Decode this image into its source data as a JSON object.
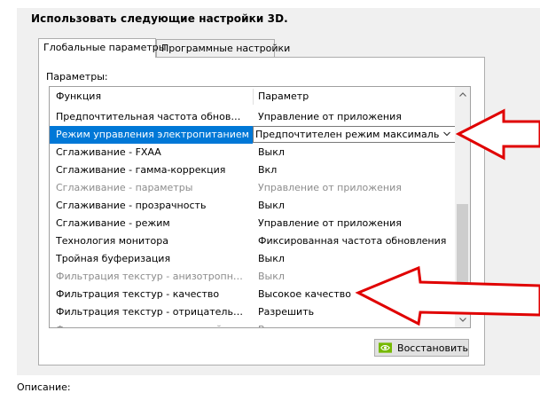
{
  "section_title": "Использовать следующие настройки 3D.",
  "tabs": [
    {
      "label": "Глобальные параметры",
      "active": true
    },
    {
      "label": "Программные настройки",
      "active": false
    }
  ],
  "params_label": "Параметры:",
  "grid": {
    "headers": {
      "function": "Функция",
      "parameter": "Параметр"
    },
    "rows": [
      {
        "function": "Предпочтительная частота обновлени...",
        "value": "Управление от приложения",
        "state": "normal"
      },
      {
        "function": "Режим управления электропитанием",
        "value": "Предпочтителен режим максимальной пр",
        "state": "selected"
      },
      {
        "function": "Сглаживание - FXAA",
        "value": "Выкл",
        "state": "normal"
      },
      {
        "function": "Сглаживание - гамма-коррекция",
        "value": "Вкл",
        "state": "normal"
      },
      {
        "function": "Сглаживание - параметры",
        "value": "Управление от приложения",
        "state": "disabled"
      },
      {
        "function": "Сглаживание - прозрачность",
        "value": "Выкл",
        "state": "normal"
      },
      {
        "function": "Сглаживание - режим",
        "value": "Управление от приложения",
        "state": "normal"
      },
      {
        "function": "Технология монитора",
        "value": "Фиксированная частота обновления",
        "state": "normal"
      },
      {
        "function": "Тройная буферизация",
        "value": "Выкл",
        "state": "normal"
      },
      {
        "function": "Фильтрация текстур - анизотропная оп...",
        "value": "Выкл",
        "state": "disabled"
      },
      {
        "function": "Фильтрация текстур - качество",
        "value": "Высокое качество",
        "state": "normal"
      },
      {
        "function": "Фильтрация текстур - отрицательное о...",
        "value": "Разрешить",
        "state": "normal"
      },
      {
        "function": "Фильтрация текстур - трилинейная оп...",
        "value": "Вкл",
        "state": "disabled"
      }
    ]
  },
  "restore_button": {
    "label": "Восстановить",
    "icon": "nvidia-logo-icon"
  },
  "description_label": "Описание:",
  "colors": {
    "selection": "#0078d7",
    "annotation_arrow": "#e00000",
    "disabled_text": "#8c8c8c"
  }
}
